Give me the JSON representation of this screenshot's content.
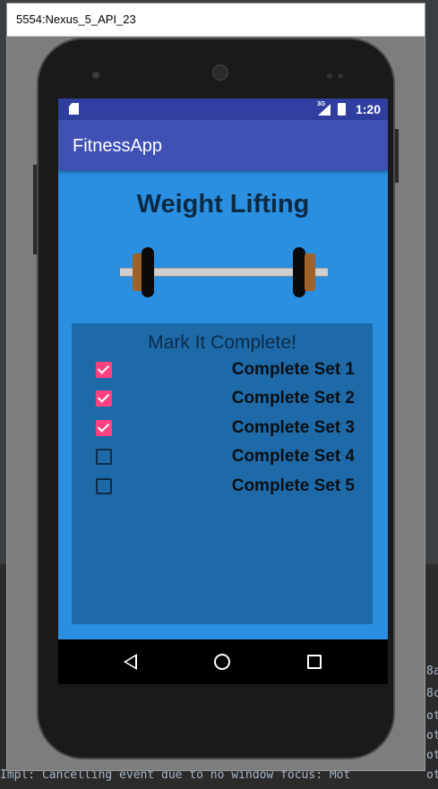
{
  "console": {
    "lines": [
      {
        "text": "Impl: Cancelling event due to no window focus: Mot",
        "kind": "normal"
      }
    ],
    "fragments": [
      "8a",
      "8c",
      "ot",
      "ot",
      "ot",
      "ot"
    ]
  },
  "emulator": {
    "window_title": "5554:Nexus_5_API_23"
  },
  "status_bar": {
    "network": "3G",
    "time": "1:20",
    "sd_icon": "sd-card-icon",
    "signal_icon": "signal-icon",
    "battery_icon": "battery-charging-icon"
  },
  "app_bar": {
    "title": "FitnessApp"
  },
  "main": {
    "heading": "Weight Lifting",
    "panel_title": "Mark It Complete!",
    "sets": [
      {
        "label": "Complete Set 1",
        "checked": true
      },
      {
        "label": "Complete Set 2",
        "checked": true
      },
      {
        "label": "Complete Set 3",
        "checked": true
      },
      {
        "label": "Complete Set 4",
        "checked": false
      },
      {
        "label": "Complete Set 5",
        "checked": false
      }
    ]
  },
  "nav_bar": {
    "back_icon": "back-triangle-icon",
    "home_icon": "home-circle-icon",
    "recents_icon": "recents-square-icon"
  },
  "colors": {
    "accent": "#ff4081",
    "primary": "#3f51b5",
    "primary_dark": "#303f9f",
    "screen_bg": "#2a8fe0",
    "panel_bg": "#1e6aa8"
  }
}
